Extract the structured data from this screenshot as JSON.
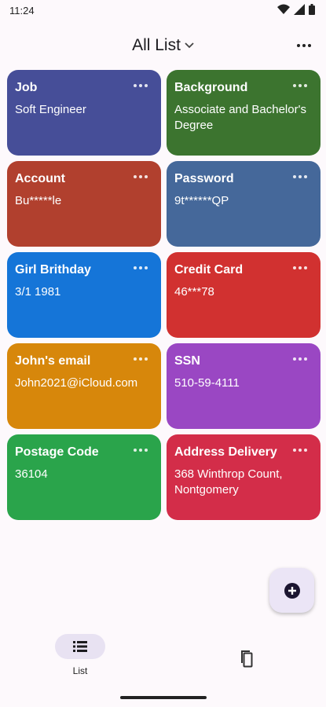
{
  "status_bar": {
    "time": "11:24"
  },
  "header": {
    "title": "All List"
  },
  "cards": [
    {
      "title": "Job",
      "value": "Soft Engineer",
      "color": "#464e98"
    },
    {
      "title": "Background",
      "value": "Associate and Bachelor's Degree",
      "color": "#3c742f"
    },
    {
      "title": "Account",
      "value": "Bu*****le",
      "color": "#b1402e"
    },
    {
      "title": "Password",
      "value": "9t******QP",
      "color": "#45689a"
    },
    {
      "title": "Girl Brithday",
      "value": "3/1 1981",
      "color": "#1575d8"
    },
    {
      "title": "Credit Card",
      "value": "46***78",
      "color": "#d13130"
    },
    {
      "title": "John's email",
      "value": "John2021@iCloud.com",
      "color": "#d7870b"
    },
    {
      "title": "SSN",
      "value": "510-59-4111",
      "color": "#9a47c3"
    },
    {
      "title": "Postage Code",
      "value": "36104",
      "color": "#2aa44b"
    },
    {
      "title": "Address Delivery",
      "value": "368 Winthrop Count, Nontgomery",
      "color": "#d32d49"
    }
  ],
  "nav": {
    "list_label": "List"
  }
}
